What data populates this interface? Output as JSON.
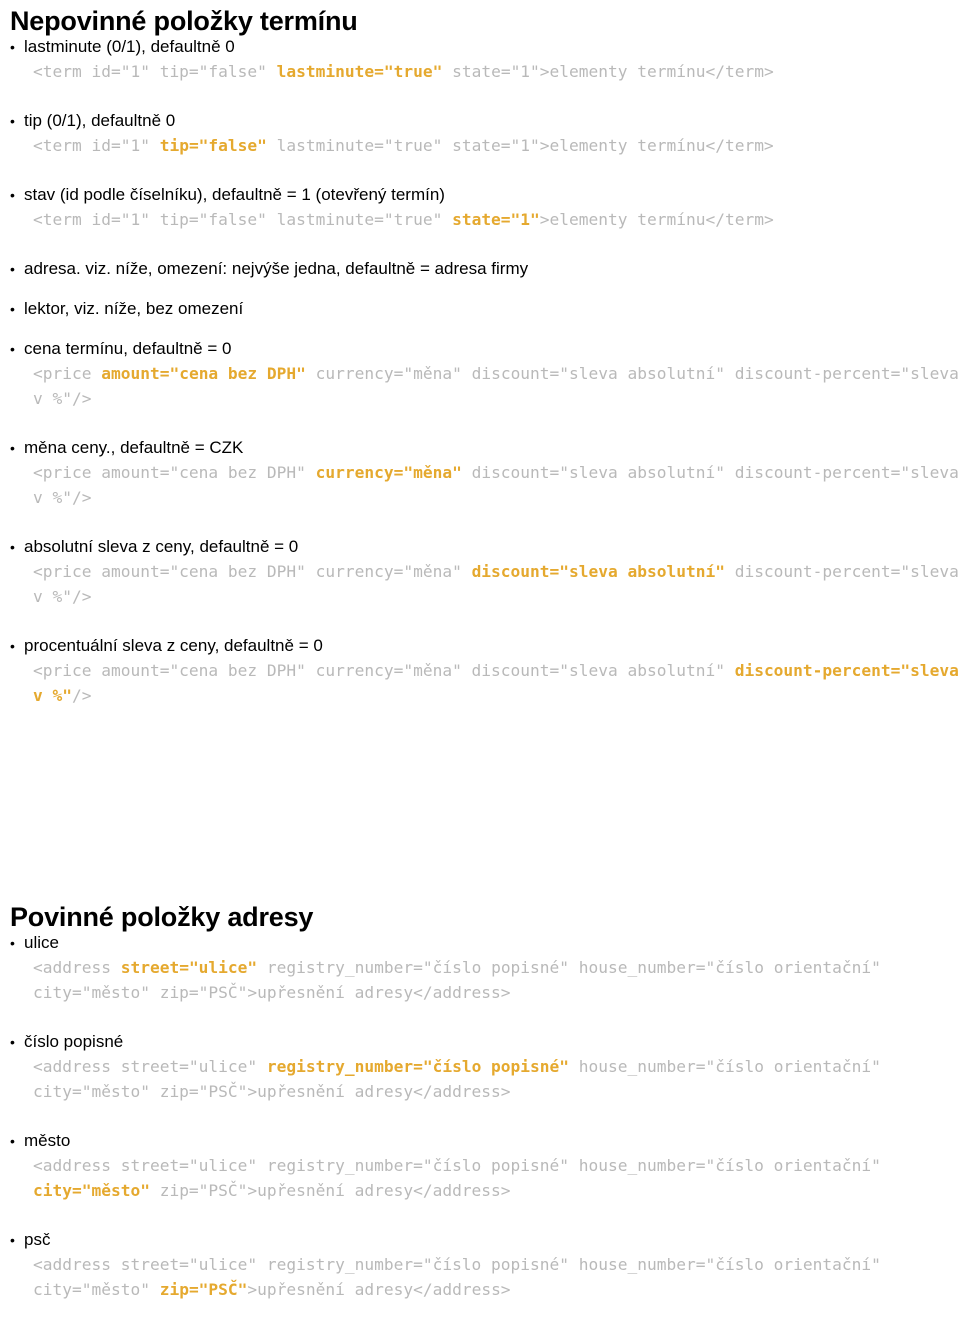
{
  "document": {
    "theme": {
      "code_gray": "#b9b9b9",
      "highlight_amber": "#e5a92f",
      "text_black": "#000000",
      "background": "#ffffff"
    }
  },
  "sections": [
    {
      "id": "nepovinne-polozky-terminu",
      "title": "Nepovinné položky termínu",
      "entries": [
        {
          "label": "lastminute (0/1), defaultně 0",
          "code_parts": [
            {
              "text": "<term id=\"1\" tip=\"false\" ",
              "highlight": false
            },
            {
              "text": "lastminute=\"true\"",
              "highlight": true
            },
            {
              "text": " state=\"1\">elementy termínu</term>",
              "highlight": false
            }
          ]
        },
        {
          "label": "tip (0/1), defaultně 0",
          "code_parts": [
            {
              "text": "<term id=\"1\" ",
              "highlight": false
            },
            {
              "text": "tip=\"false\"",
              "highlight": true
            },
            {
              "text": " lastminute=\"true\" state=\"1\">elementy termínu</term>",
              "highlight": false
            }
          ]
        },
        {
          "label": "stav (id podle číselníku), defaultně = 1 (otevřený termín)",
          "code_parts": [
            {
              "text": "<term id=\"1\" tip=\"false\" lastminute=\"true\" ",
              "highlight": false
            },
            {
              "text": "state=\"1\"",
              "highlight": true
            },
            {
              "text": ">elementy termínu</term>",
              "highlight": false
            }
          ]
        },
        {
          "label": "adresa. viz. níže, omezení: nejvýše jedna, defaultně = adresa firmy",
          "code_parts": []
        },
        {
          "label": "lektor, viz. níže, bez omezení",
          "code_parts": []
        },
        {
          "label": "cena termínu, defaultně = 0",
          "code_parts": [
            {
              "text": "<price ",
              "highlight": false
            },
            {
              "text": "amount=\"cena bez DPH\"",
              "highlight": true
            },
            {
              "text": " currency=\"měna\" discount=\"sleva absolutní\" discount-percent=\"sleva v %\"/>",
              "highlight": false
            }
          ]
        },
        {
          "label": "měna ceny., defaultně = CZK",
          "code_parts": [
            {
              "text": "<price amount=\"cena bez DPH\" ",
              "highlight": false
            },
            {
              "text": "currency=\"měna\"",
              "highlight": true
            },
            {
              "text": " discount=\"sleva absolutní\" discount-percent=\"sleva v %\"/>",
              "highlight": false
            }
          ]
        },
        {
          "label": "absolutní sleva z ceny, defaultně = 0",
          "code_parts": [
            {
              "text": "<price amount=\"cena bez DPH\" currency=\"měna\" ",
              "highlight": false
            },
            {
              "text": "discount=\"sleva absolutní\"",
              "highlight": true
            },
            {
              "text": " discount-percent=\"sleva v %\"/>",
              "highlight": false
            }
          ]
        },
        {
          "label": "procentuální sleva z ceny, defaultně = 0",
          "code_parts": [
            {
              "text": "<price amount=\"cena bez DPH\" currency=\"měna\" discount=\"sleva absolutní\" ",
              "highlight": false
            },
            {
              "text": "discount-percent=\"sleva v %\"",
              "highlight": true
            },
            {
              "text": "/>",
              "highlight": false
            }
          ]
        }
      ]
    },
    {
      "id": "povinne-polozky-adresy",
      "title": "Povinné položky adresy",
      "entries": [
        {
          "label": "ulice",
          "code_parts": [
            {
              "text": "<address ",
              "highlight": false
            },
            {
              "text": "street=\"ulice\"",
              "highlight": true
            },
            {
              "text": " registry_number=\"číslo popisné\" house_number=\"číslo orientační\" city=\"město\" zip=\"PSČ\">upřesnění adresy</address>",
              "highlight": false
            }
          ]
        },
        {
          "label": "číslo popisné",
          "code_parts": [
            {
              "text": "<address street=\"ulice\" ",
              "highlight": false
            },
            {
              "text": "registry_number=\"číslo popisné\"",
              "highlight": true
            },
            {
              "text": " house_number=\"číslo orientační\" city=\"město\" zip=\"PSČ\">upřesnění adresy</address>",
              "highlight": false
            }
          ]
        },
        {
          "label": "město",
          "code_parts": [
            {
              "text": "<address street=\"ulice\" registry_number=\"číslo popisné\" house_number=\"číslo orientační\" ",
              "highlight": false
            },
            {
              "text": "city=\"město\"",
              "highlight": true
            },
            {
              "text": " zip=\"PSČ\">upřesnění adresy</address>",
              "highlight": false
            }
          ]
        },
        {
          "label": "psč",
          "code_parts": [
            {
              "text": "<address street=\"ulice\" registry_number=\"číslo popisné\" house_number=\"číslo orientační\" city=\"město\" ",
              "highlight": false
            },
            {
              "text": "zip=\"PSČ\"",
              "highlight": true
            },
            {
              "text": ">upřesnění adresy</address>",
              "highlight": false
            }
          ]
        }
      ]
    }
  ]
}
